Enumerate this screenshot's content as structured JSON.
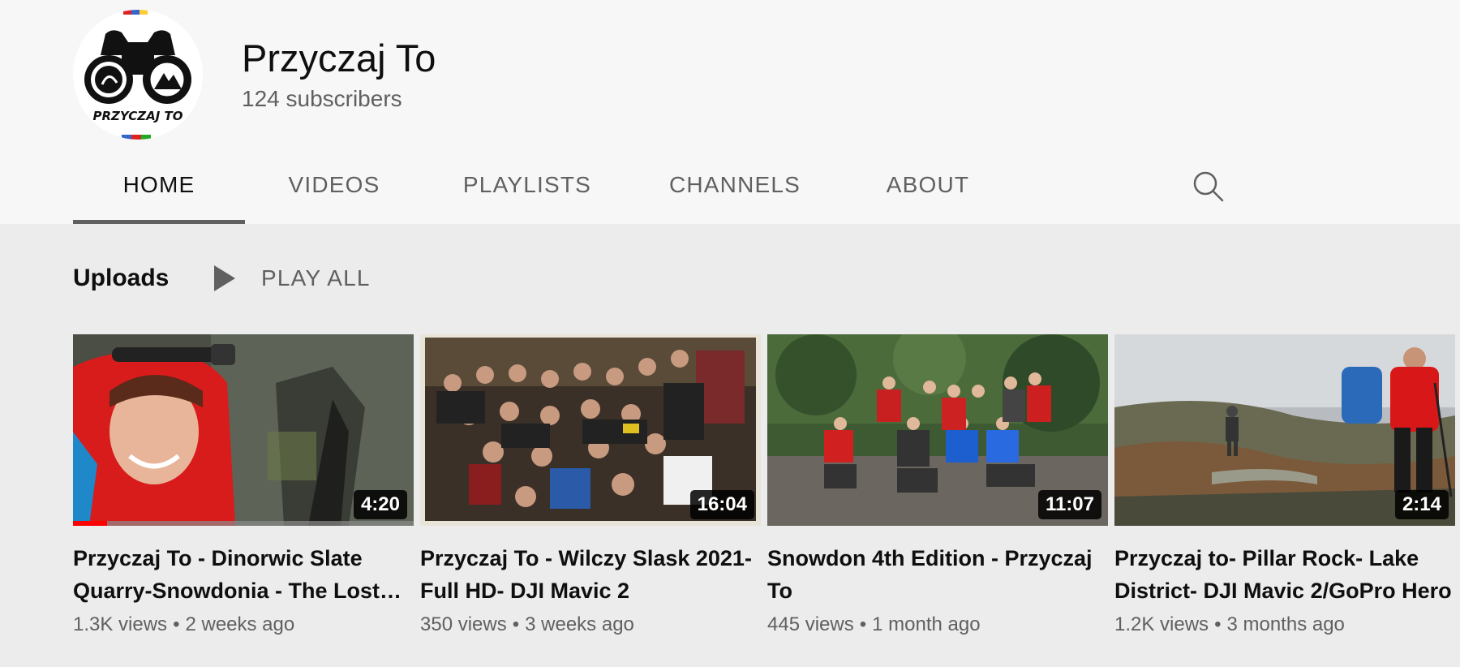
{
  "channel": {
    "name": "Przyczaj To",
    "subscribers": "124 subscribers",
    "avatar_text": "PRZYCZAJ TO"
  },
  "tabs": [
    {
      "label": "HOME",
      "active": true
    },
    {
      "label": "VIDEOS",
      "active": false
    },
    {
      "label": "PLAYLISTS",
      "active": false
    },
    {
      "label": "CHANNELS",
      "active": false
    },
    {
      "label": "ABOUT",
      "active": false
    }
  ],
  "shelf": {
    "title": "Uploads",
    "play_all": "PLAY ALL"
  },
  "videos": [
    {
      "title": "Przyczaj To - Dinorwic Slate Quarry-Snowdonia - The Lost World",
      "duration": "4:20",
      "views": "1.3K views",
      "age": "2 weeks ago",
      "watched_fraction": 0.1
    },
    {
      "title": "Przyczaj To - Wilczy Slask 2021- Full HD- DJI Mavic 2",
      "duration": "16:04",
      "views": "350 views",
      "age": "3 weeks ago"
    },
    {
      "title": "Snowdon 4th Edition - Przyczaj To",
      "duration": "11:07",
      "views": "445 views",
      "age": "1 month ago"
    },
    {
      "title": "Przyczaj to- Pillar Rock- Lake District- DJI Mavic 2/GoPro Hero",
      "duration": "2:14",
      "views": "1.2K views",
      "age": "3 months ago"
    }
  ],
  "colors": {
    "accent_red": "#ff0000",
    "text_primary": "#0f0f0f",
    "text_secondary": "#606060"
  },
  "icons": {
    "search": "search-icon",
    "play": "play-icon",
    "avatar": "binoculars-logo-icon"
  }
}
